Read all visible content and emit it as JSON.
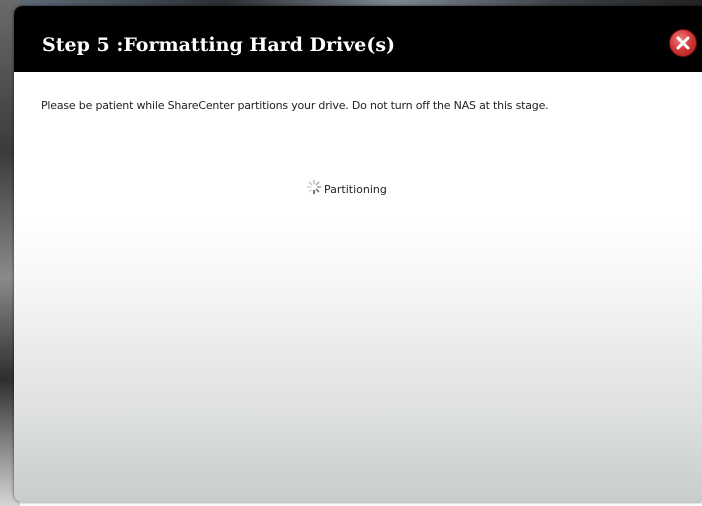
{
  "dialog": {
    "title": "Step 5 :Formatting Hard Drive(s)",
    "message": "Please be patient while ShareCenter partitions your drive. Do not turn off the NAS at this stage.",
    "status_label": "Partitioning",
    "close_icon": "close-icon",
    "spinner_icon": "loading-spinner-icon"
  },
  "colors": {
    "titlebar_bg": "#000000",
    "title_text": "#ffffff",
    "close_button": "#d23a3a",
    "body_text": "#222222"
  }
}
